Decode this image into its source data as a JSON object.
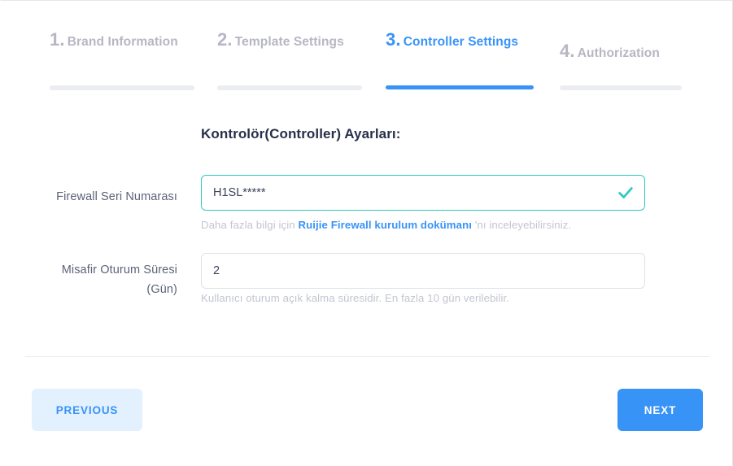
{
  "stepper": {
    "steps": [
      {
        "number": "1.",
        "label": "Brand Information",
        "active": false
      },
      {
        "number": "2.",
        "label": "Template Settings",
        "active": false
      },
      {
        "number": "3.",
        "label": "Controller Settings",
        "active": true
      },
      {
        "number": "4.",
        "label": "Authorization",
        "active": false
      }
    ],
    "active_color": "#3893f7",
    "inactive_color": "#b6b7c3",
    "bar_inactive_color": "#ecedf0"
  },
  "form": {
    "heading": "Kontrolör(Controller) Ayarları:",
    "fields": [
      {
        "label": "Firewall Seri Numarası",
        "value": "H1SL*****",
        "placeholder": "",
        "valid": true,
        "valid_color": "#2fc9c0",
        "helper_prefix": "Daha fazla bilgi için ",
        "helper_link": "Ruijie Firewall kurulum dokümanı",
        "helper_suffix": " 'nı inceleyebilirsiniz."
      },
      {
        "label": "Misafir Oturum Süresi (Gün)",
        "label_line1": "Misafir Oturum Süresi",
        "label_line2": "(Gün)",
        "value": "2",
        "placeholder": "",
        "valid": false,
        "helper_prefix": "Kullanıcı oturum açık kalma süresidir. En fazla 10 gün verilebilir.",
        "helper_link": "",
        "helper_suffix": ""
      }
    ]
  },
  "footer": {
    "previous_label": "PREVIOUS",
    "next_label": "NEXT",
    "previous_bg": "#e3f0fe",
    "next_bg": "#3893f7"
  }
}
